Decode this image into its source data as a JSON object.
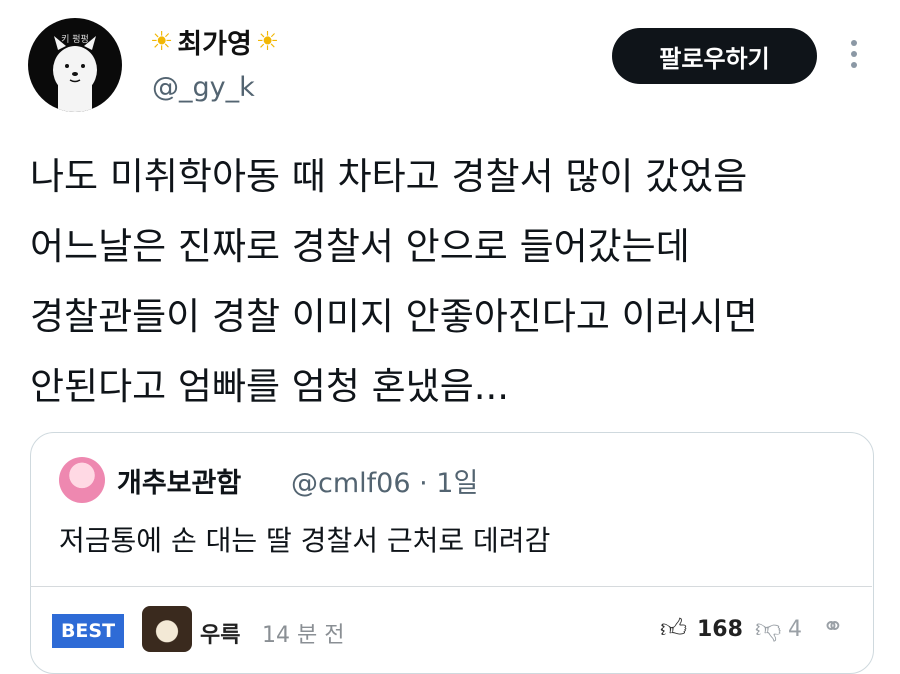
{
  "author": {
    "display_name": "최가영",
    "handle": "@_gy_k",
    "avatar_caption": "키 펑펑"
  },
  "follow_label": "팔로우하기",
  "tweet_lines": [
    "나도 미취학아동 때 차타고 경찰서 많이 갔었음",
    "어느날은 진짜로 경찰서 안으로 들어갔는데",
    "경찰관들이 경찰 이미지 안좋아진다고 이러시면",
    "안된다고 엄빠를 엄청 혼냈음..."
  ],
  "quote": {
    "name": "개추보관함",
    "handle": "@cmlf06",
    "separator": "·",
    "time": "1일",
    "text": "저금통에 손 대는 딸 경찰서 근처로 데려감"
  },
  "comment": {
    "badge": "BEST",
    "username": "우륵",
    "time": "14 분 전",
    "likes": "168",
    "dislikes": "4"
  },
  "icons": {
    "sun": "sun-emoji-icon",
    "more": "vertical-ellipsis-icon",
    "like": "thumbs-up-icon",
    "dislike": "thumbs-down-icon",
    "share": "share-icon"
  },
  "colors": {
    "follow_button": "#0f1419",
    "best_badge": "#2e6bd6",
    "secondary_text": "#536471"
  }
}
